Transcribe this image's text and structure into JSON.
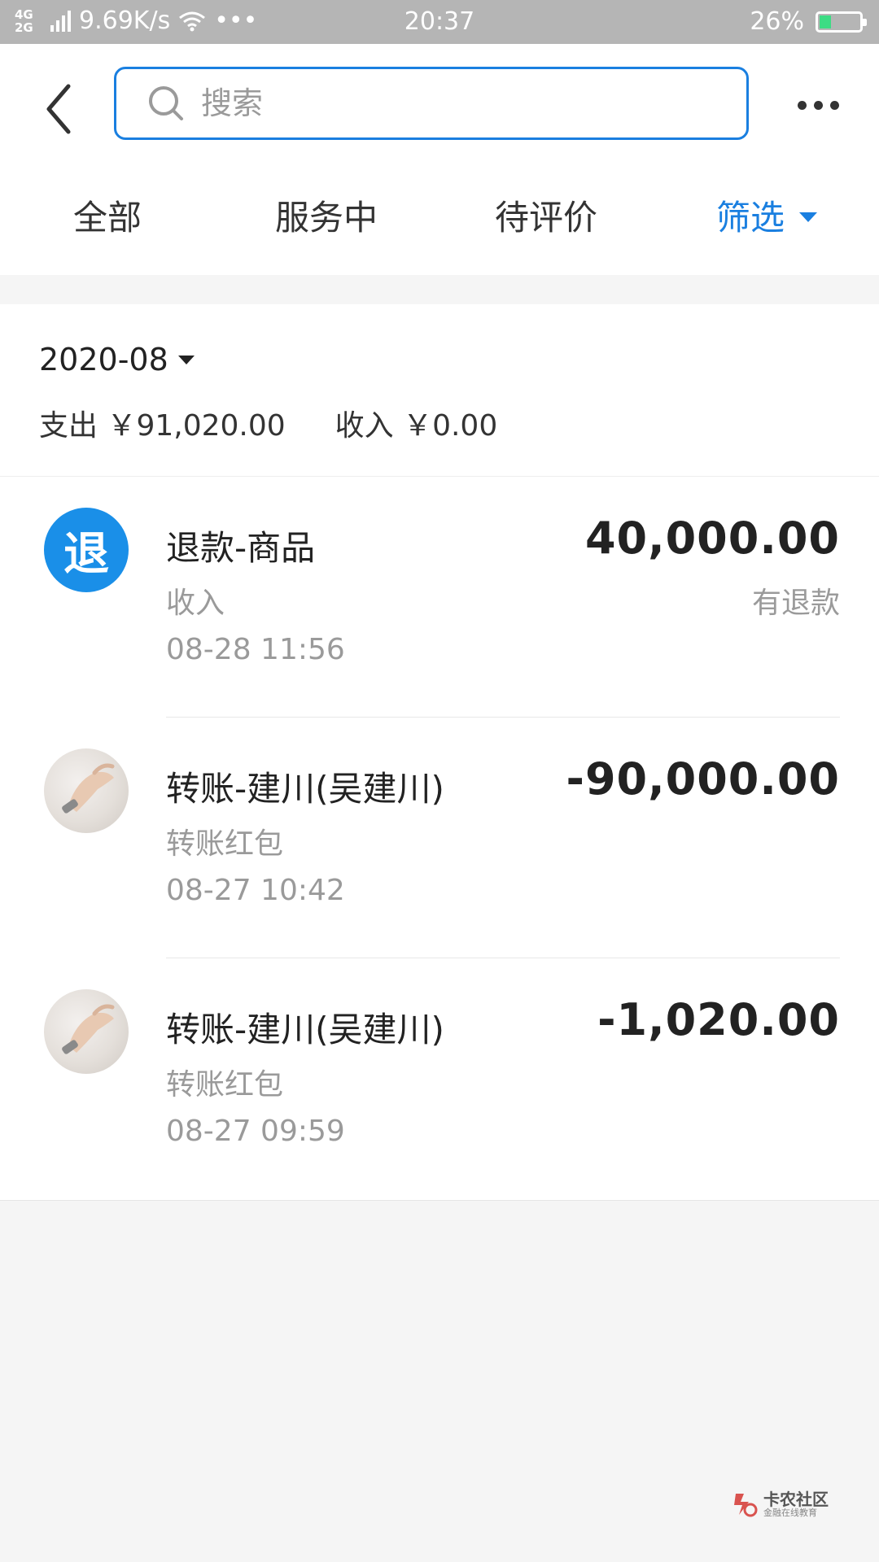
{
  "status_bar": {
    "network": "4G 2G",
    "speed": "9.69K/s",
    "extra": "•••",
    "time": "20:37",
    "battery": "26%"
  },
  "search": {
    "placeholder": "搜索"
  },
  "tabs": [
    {
      "label": "全部"
    },
    {
      "label": "服务中"
    },
    {
      "label": "待评价"
    },
    {
      "label": "筛选"
    }
  ],
  "summary": {
    "month": "2020-08",
    "expense_label": "支出",
    "expense_value": "￥91,020.00",
    "income_label": "收入",
    "income_value": "￥0.00"
  },
  "transactions": [
    {
      "avatar_text": "退",
      "title": "退款-商品",
      "subtitle": "收入",
      "date": "08-28  11:56",
      "amount": "40,000.00",
      "status": "有退款"
    },
    {
      "title": "转账-建川(吴建川)",
      "subtitle": "转账红包",
      "date": "08-27  10:42",
      "amount": "-90,000.00"
    },
    {
      "title": "转账-建川(吴建川)",
      "subtitle": "转账红包",
      "date": "08-27  09:59",
      "amount": "-1,020.00"
    }
  ],
  "watermark": {
    "main": "卡农社区",
    "sub": "金融在线教育"
  },
  "colors": {
    "accent": "#1a7fe0",
    "status_bar": "#b5b5b5",
    "refund_avatar": "#1a8fe8"
  }
}
